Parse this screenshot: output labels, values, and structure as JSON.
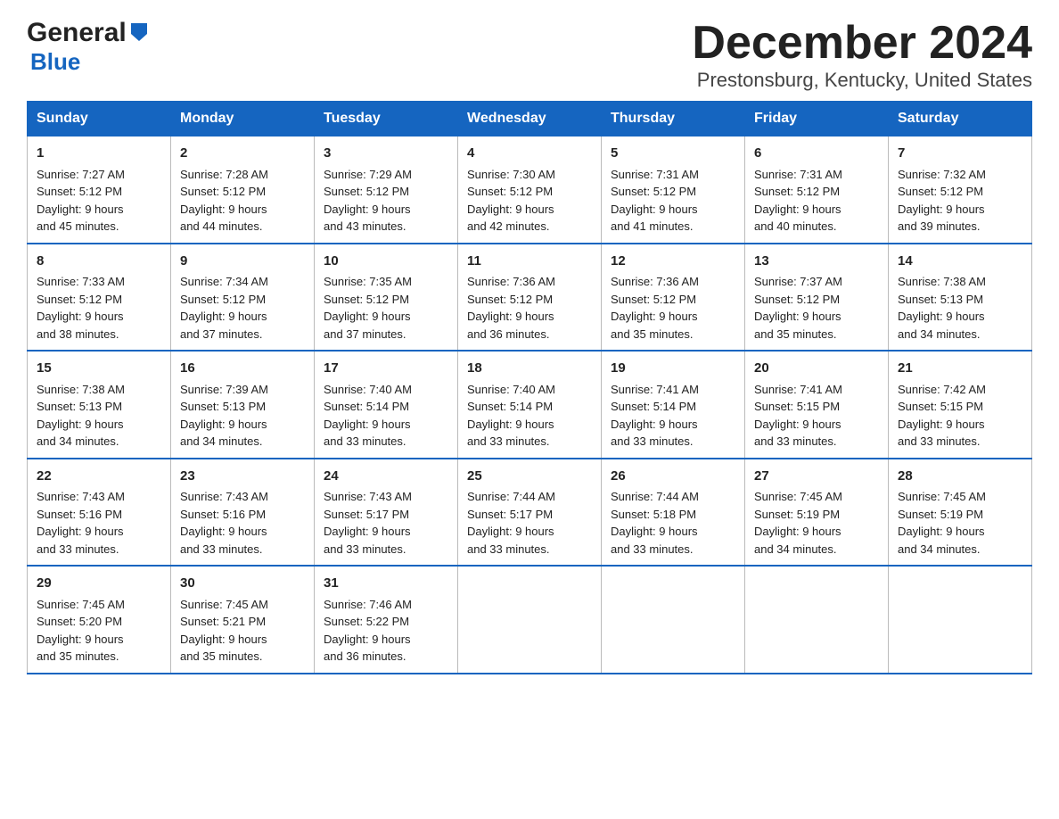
{
  "logo": {
    "general": "General",
    "blue": "Blue"
  },
  "title": "December 2024",
  "subtitle": "Prestonsburg, Kentucky, United States",
  "weekdays": [
    "Sunday",
    "Monday",
    "Tuesday",
    "Wednesday",
    "Thursday",
    "Friday",
    "Saturday"
  ],
  "weeks": [
    [
      {
        "day": "1",
        "sunrise": "Sunrise: 7:27 AM",
        "sunset": "Sunset: 5:12 PM",
        "daylight": "Daylight: 9 hours",
        "daylight2": "and 45 minutes."
      },
      {
        "day": "2",
        "sunrise": "Sunrise: 7:28 AM",
        "sunset": "Sunset: 5:12 PM",
        "daylight": "Daylight: 9 hours",
        "daylight2": "and 44 minutes."
      },
      {
        "day": "3",
        "sunrise": "Sunrise: 7:29 AM",
        "sunset": "Sunset: 5:12 PM",
        "daylight": "Daylight: 9 hours",
        "daylight2": "and 43 minutes."
      },
      {
        "day": "4",
        "sunrise": "Sunrise: 7:30 AM",
        "sunset": "Sunset: 5:12 PM",
        "daylight": "Daylight: 9 hours",
        "daylight2": "and 42 minutes."
      },
      {
        "day": "5",
        "sunrise": "Sunrise: 7:31 AM",
        "sunset": "Sunset: 5:12 PM",
        "daylight": "Daylight: 9 hours",
        "daylight2": "and 41 minutes."
      },
      {
        "day": "6",
        "sunrise": "Sunrise: 7:31 AM",
        "sunset": "Sunset: 5:12 PM",
        "daylight": "Daylight: 9 hours",
        "daylight2": "and 40 minutes."
      },
      {
        "day": "7",
        "sunrise": "Sunrise: 7:32 AM",
        "sunset": "Sunset: 5:12 PM",
        "daylight": "Daylight: 9 hours",
        "daylight2": "and 39 minutes."
      }
    ],
    [
      {
        "day": "8",
        "sunrise": "Sunrise: 7:33 AM",
        "sunset": "Sunset: 5:12 PM",
        "daylight": "Daylight: 9 hours",
        "daylight2": "and 38 minutes."
      },
      {
        "day": "9",
        "sunrise": "Sunrise: 7:34 AM",
        "sunset": "Sunset: 5:12 PM",
        "daylight": "Daylight: 9 hours",
        "daylight2": "and 37 minutes."
      },
      {
        "day": "10",
        "sunrise": "Sunrise: 7:35 AM",
        "sunset": "Sunset: 5:12 PM",
        "daylight": "Daylight: 9 hours",
        "daylight2": "and 37 minutes."
      },
      {
        "day": "11",
        "sunrise": "Sunrise: 7:36 AM",
        "sunset": "Sunset: 5:12 PM",
        "daylight": "Daylight: 9 hours",
        "daylight2": "and 36 minutes."
      },
      {
        "day": "12",
        "sunrise": "Sunrise: 7:36 AM",
        "sunset": "Sunset: 5:12 PM",
        "daylight": "Daylight: 9 hours",
        "daylight2": "and 35 minutes."
      },
      {
        "day": "13",
        "sunrise": "Sunrise: 7:37 AM",
        "sunset": "Sunset: 5:12 PM",
        "daylight": "Daylight: 9 hours",
        "daylight2": "and 35 minutes."
      },
      {
        "day": "14",
        "sunrise": "Sunrise: 7:38 AM",
        "sunset": "Sunset: 5:13 PM",
        "daylight": "Daylight: 9 hours",
        "daylight2": "and 34 minutes."
      }
    ],
    [
      {
        "day": "15",
        "sunrise": "Sunrise: 7:38 AM",
        "sunset": "Sunset: 5:13 PM",
        "daylight": "Daylight: 9 hours",
        "daylight2": "and 34 minutes."
      },
      {
        "day": "16",
        "sunrise": "Sunrise: 7:39 AM",
        "sunset": "Sunset: 5:13 PM",
        "daylight": "Daylight: 9 hours",
        "daylight2": "and 34 minutes."
      },
      {
        "day": "17",
        "sunrise": "Sunrise: 7:40 AM",
        "sunset": "Sunset: 5:14 PM",
        "daylight": "Daylight: 9 hours",
        "daylight2": "and 33 minutes."
      },
      {
        "day": "18",
        "sunrise": "Sunrise: 7:40 AM",
        "sunset": "Sunset: 5:14 PM",
        "daylight": "Daylight: 9 hours",
        "daylight2": "and 33 minutes."
      },
      {
        "day": "19",
        "sunrise": "Sunrise: 7:41 AM",
        "sunset": "Sunset: 5:14 PM",
        "daylight": "Daylight: 9 hours",
        "daylight2": "and 33 minutes."
      },
      {
        "day": "20",
        "sunrise": "Sunrise: 7:41 AM",
        "sunset": "Sunset: 5:15 PM",
        "daylight": "Daylight: 9 hours",
        "daylight2": "and 33 minutes."
      },
      {
        "day": "21",
        "sunrise": "Sunrise: 7:42 AM",
        "sunset": "Sunset: 5:15 PM",
        "daylight": "Daylight: 9 hours",
        "daylight2": "and 33 minutes."
      }
    ],
    [
      {
        "day": "22",
        "sunrise": "Sunrise: 7:43 AM",
        "sunset": "Sunset: 5:16 PM",
        "daylight": "Daylight: 9 hours",
        "daylight2": "and 33 minutes."
      },
      {
        "day": "23",
        "sunrise": "Sunrise: 7:43 AM",
        "sunset": "Sunset: 5:16 PM",
        "daylight": "Daylight: 9 hours",
        "daylight2": "and 33 minutes."
      },
      {
        "day": "24",
        "sunrise": "Sunrise: 7:43 AM",
        "sunset": "Sunset: 5:17 PM",
        "daylight": "Daylight: 9 hours",
        "daylight2": "and 33 minutes."
      },
      {
        "day": "25",
        "sunrise": "Sunrise: 7:44 AM",
        "sunset": "Sunset: 5:17 PM",
        "daylight": "Daylight: 9 hours",
        "daylight2": "and 33 minutes."
      },
      {
        "day": "26",
        "sunrise": "Sunrise: 7:44 AM",
        "sunset": "Sunset: 5:18 PM",
        "daylight": "Daylight: 9 hours",
        "daylight2": "and 33 minutes."
      },
      {
        "day": "27",
        "sunrise": "Sunrise: 7:45 AM",
        "sunset": "Sunset: 5:19 PM",
        "daylight": "Daylight: 9 hours",
        "daylight2": "and 34 minutes."
      },
      {
        "day": "28",
        "sunrise": "Sunrise: 7:45 AM",
        "sunset": "Sunset: 5:19 PM",
        "daylight": "Daylight: 9 hours",
        "daylight2": "and 34 minutes."
      }
    ],
    [
      {
        "day": "29",
        "sunrise": "Sunrise: 7:45 AM",
        "sunset": "Sunset: 5:20 PM",
        "daylight": "Daylight: 9 hours",
        "daylight2": "and 35 minutes."
      },
      {
        "day": "30",
        "sunrise": "Sunrise: 7:45 AM",
        "sunset": "Sunset: 5:21 PM",
        "daylight": "Daylight: 9 hours",
        "daylight2": "and 35 minutes."
      },
      {
        "day": "31",
        "sunrise": "Sunrise: 7:46 AM",
        "sunset": "Sunset: 5:22 PM",
        "daylight": "Daylight: 9 hours",
        "daylight2": "and 36 minutes."
      },
      {
        "day": "",
        "sunrise": "",
        "sunset": "",
        "daylight": "",
        "daylight2": ""
      },
      {
        "day": "",
        "sunrise": "",
        "sunset": "",
        "daylight": "",
        "daylight2": ""
      },
      {
        "day": "",
        "sunrise": "",
        "sunset": "",
        "daylight": "",
        "daylight2": ""
      },
      {
        "day": "",
        "sunrise": "",
        "sunset": "",
        "daylight": "",
        "daylight2": ""
      }
    ]
  ]
}
